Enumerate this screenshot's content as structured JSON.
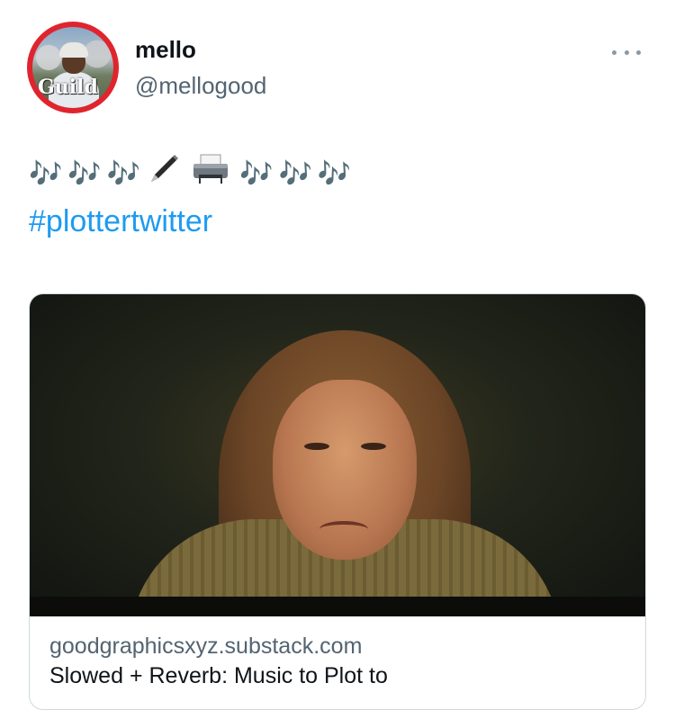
{
  "tweet": {
    "display_name": "mello",
    "handle": "@mellogood",
    "avatar_logo_text": "Guild",
    "more_icon": "more-horizontal-icon",
    "emoji": {
      "note": "🎶",
      "pen": "pen-icon",
      "printer": "printer-icon"
    },
    "hashtag": "#plottertwitter"
  },
  "card": {
    "image_icon": "card-image",
    "domain": "goodgraphicsxyz.substack.com",
    "title": "Slowed + Reverb: Music to Plot to"
  },
  "colors": {
    "avatar_ring": "#e0242e",
    "link": "#1d9bf0",
    "secondary_text": "#536471",
    "border": "#cfd9de"
  }
}
